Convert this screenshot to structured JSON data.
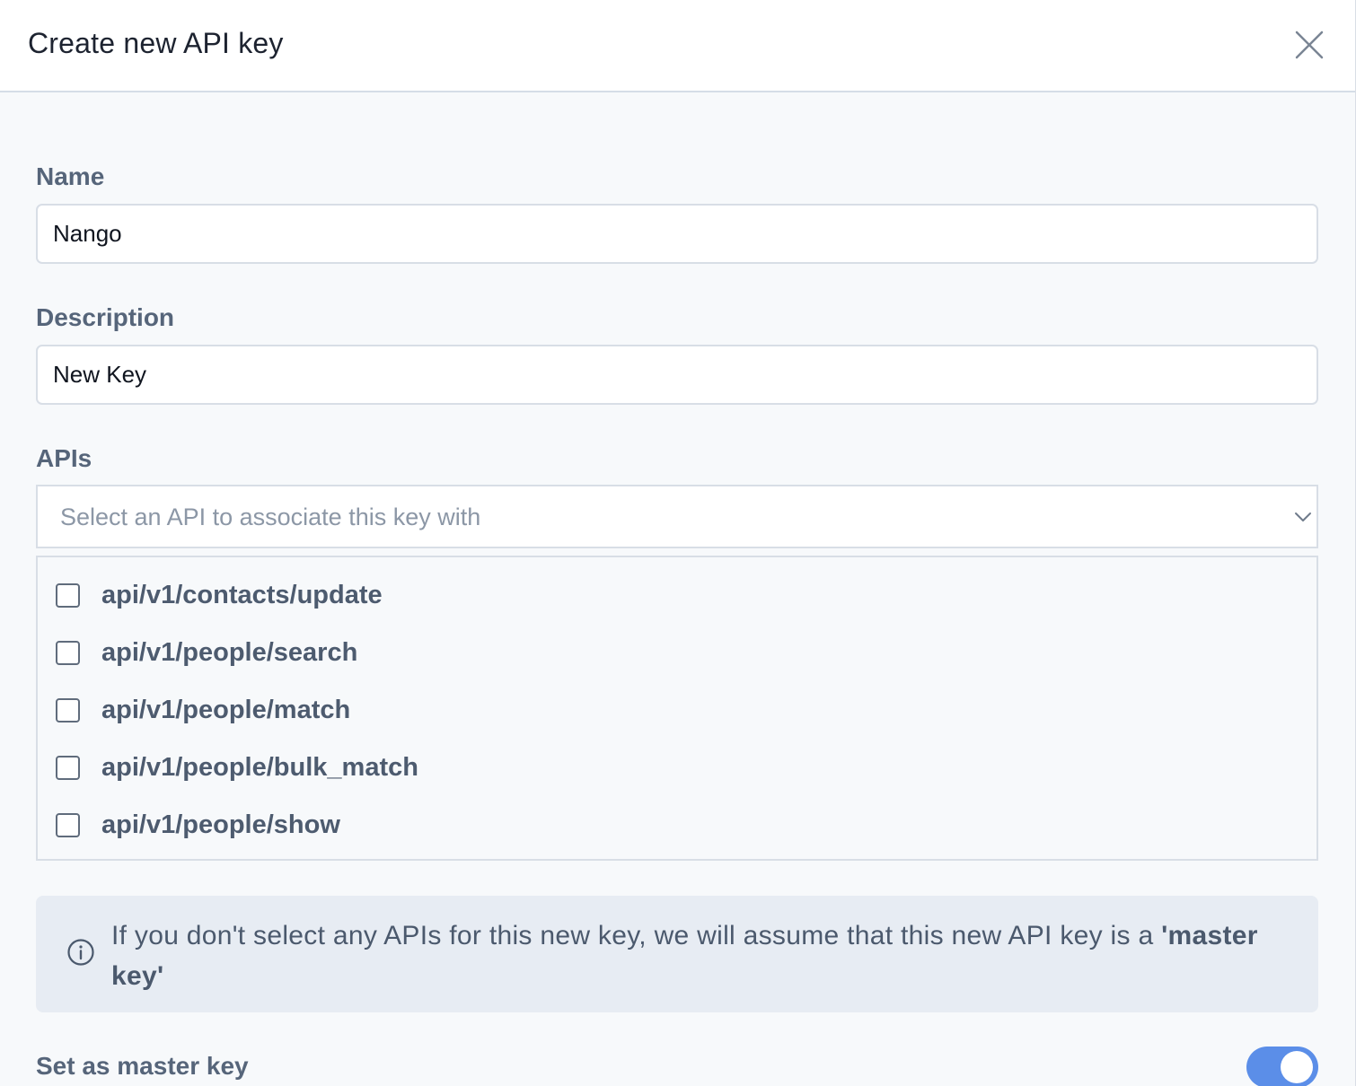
{
  "header": {
    "title": "Create new API key",
    "close_icon": "close-icon"
  },
  "form": {
    "name": {
      "label": "Name",
      "value": "Nango"
    },
    "description": {
      "label": "Description",
      "value": "New Key"
    },
    "apis": {
      "label": "APIs",
      "placeholder": "Select an API to associate this key with",
      "options": [
        {
          "label": "api/v1/contacts/update",
          "checked": false
        },
        {
          "label": "api/v1/people/search",
          "checked": false
        },
        {
          "label": "api/v1/people/match",
          "checked": false
        },
        {
          "label": "api/v1/people/bulk_match",
          "checked": false
        },
        {
          "label": "api/v1/people/show",
          "checked": false
        }
      ]
    },
    "info": {
      "text_before": "If you don't select any APIs for this new key, we will assume that this new API key is a ",
      "text_strong": "'master key'"
    },
    "master_key": {
      "label": "Set as master key",
      "enabled": true
    }
  },
  "colors": {
    "accent": "#5b8ee8",
    "info_bg": "#e7ecf3",
    "label": "#56657a"
  }
}
